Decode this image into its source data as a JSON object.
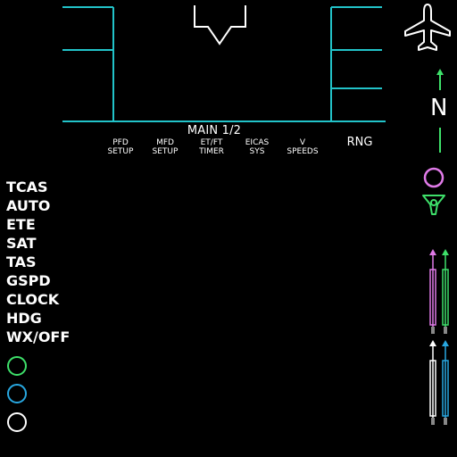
{
  "header": {
    "title": "MAIN 1/2"
  },
  "softkeys": [
    {
      "line1": "PFD",
      "line2": "SETUP"
    },
    {
      "line1": "MFD",
      "line2": "SETUP"
    },
    {
      "line1": "ET/FT",
      "line2": "TIMER"
    },
    {
      "line1": "EICAS",
      "line2": "SYS"
    },
    {
      "line1": "V",
      "line2": "SPEEDS"
    }
  ],
  "range_label": "RNG",
  "left_menu": [
    "TCAS",
    "AUTO",
    "ETE",
    "SAT",
    "TAS",
    "GSPD",
    "CLOCK",
    "HDG",
    "WX/OFF"
  ],
  "compass": {
    "label": "N"
  },
  "icons": {
    "top_right": "airplane-icon",
    "north_arrow": "north-arrow-icon",
    "waypoint": "magenta-circle-icon",
    "vor": "green-vor-icon",
    "left_circles": [
      "green-circle-icon",
      "blue-circle-icon",
      "white-circle-icon"
    ],
    "bearing_pointers": [
      "magenta-pointer-icon",
      "green-pointer-icon",
      "white-pointer-icon",
      "blue-pointer-icon"
    ]
  },
  "colors": {
    "frame": "#22c3c9",
    "green": "#3ee06a",
    "magenta": "#e07ae8",
    "blue": "#28a7e0",
    "white": "#ffffff"
  }
}
